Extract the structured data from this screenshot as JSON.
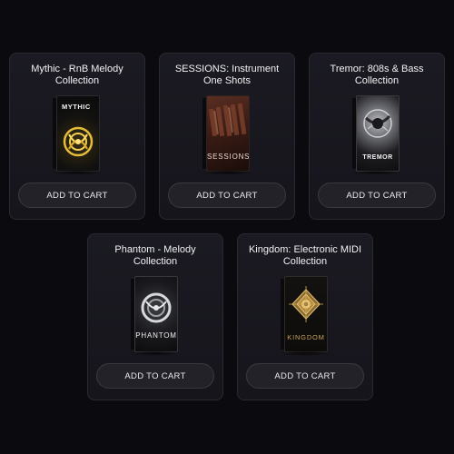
{
  "products": [
    {
      "title": "Mythic - RnB Melody Collection",
      "box_label": "MYTHIC",
      "cta": "ADD TO CART",
      "accent": "#e0b53a"
    },
    {
      "title": "SESSIONS: Instrument One Shots",
      "box_label": "SESSIONS",
      "cta": "ADD TO CART",
      "accent": "#b8714a"
    },
    {
      "title": "Tremor: 808s & Bass Collection",
      "box_label": "TREMOR",
      "cta": "ADD TO CART",
      "accent": "#bfc0c4"
    },
    {
      "title": "Phantom - Melody Collection",
      "box_label": "PHANTOM",
      "cta": "ADD TO CART",
      "accent": "#cfd0d4"
    },
    {
      "title": "Kingdom: Electronic MIDI Collection",
      "box_label": "KINGDOM",
      "cta": "ADD TO CART",
      "accent": "#c8a054"
    }
  ]
}
